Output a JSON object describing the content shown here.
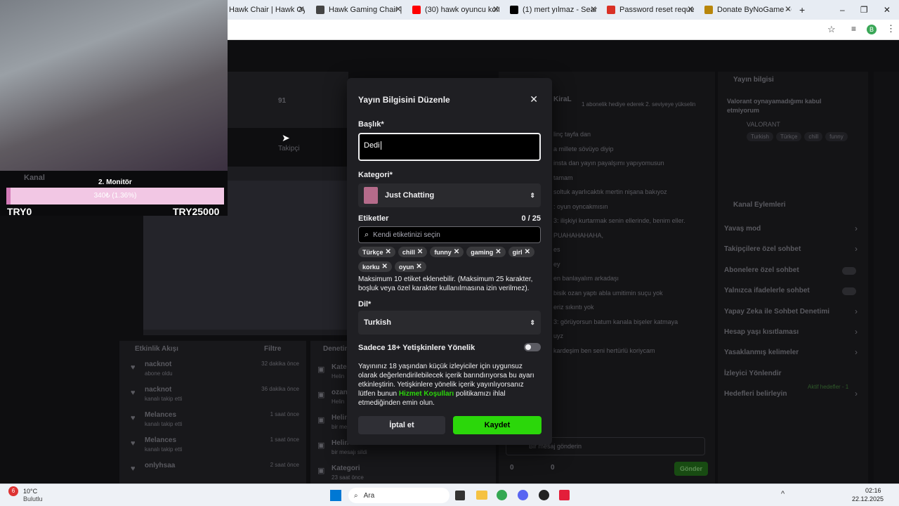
{
  "browser": {
    "tabs": [
      {
        "label": "Hawk Chair | Hawk Oyunc",
        "color": "#ffffff"
      },
      {
        "label": "Hawk Gaming Chair | İsim",
        "color": "#444444"
      },
      {
        "label": "(30) hawk oyuncu koltuğu",
        "color": "#ff0000"
      },
      {
        "label": "(1) mert yılmaz - Sear",
        "color": "#000000"
      },
      {
        "label": "Password reset request -",
        "color": "#d93025"
      },
      {
        "label": "Donate ByNoGame - Gel",
        "color": "#b8860b"
      }
    ],
    "new_tab": "+"
  },
  "overlay": {
    "kanal": "Kanal",
    "monitor": "2. Monitör",
    "progress_text": "340₺ (1.36%)",
    "progress_fraction": 0.0136,
    "goal_left": "TRY0",
    "goal_right": "TRY25000"
  },
  "stats": {
    "followers_count": "91",
    "followers_label": "Takipçi"
  },
  "activity": {
    "title": "Etkinlik Akışı",
    "filter": "Filtre",
    "items": [
      {
        "name": "nacknot",
        "desc": "abone oldu",
        "time": "32 dakika önce"
      },
      {
        "name": "nacknot",
        "desc": "kanalı takip etti",
        "time": "36 dakika önce"
      },
      {
        "name": "Melances",
        "desc": "kanalı takip etti",
        "time": "1 saat önce"
      },
      {
        "name": "Melances",
        "desc": "kanalı takip etti",
        "time": "1 saat önce"
      },
      {
        "name": "onlyhsaa",
        "desc": "",
        "time": "2 saat önce"
      }
    ]
  },
  "denetim": {
    "title": "Denetim",
    "items": [
      {
        "name": "Kate",
        "desc": "Helin"
      },
      {
        "name": "ozan",
        "desc": "Helin"
      },
      {
        "name": "Helin",
        "desc": "bir mesajı sildi"
      },
      {
        "name": "Helin",
        "desc": "bir mesajı sildi"
      },
      {
        "name": "Kategori",
        "desc": "23 saat önce"
      }
    ]
  },
  "chat": {
    "header_user": "KiraL",
    "sub_banner": "1 abonelik hediye ederek 2. seviyeye yükselin",
    "messages": [
      "linç tayfa dan",
      "a millete sövüyo diyip",
      "insta dan yayın payalşımı yapıyomusun",
      "tamam",
      "soltuk ayarlıcaktık mertin nişana bakıyoz",
      ": oyun oyncakmısın",
      "3: ilişkiyi kurtarmak senin ellerinde, benim eller.",
      "PUAHAHAHAHA,",
      "es",
      "ey",
      "en banlayalım arkadaşı",
      "bisik ozan yaptı abla umitimin suçu yok",
      "eriz sıkıntı yok",
      "3: görüyorsun batum kanala bişeler katmaya",
      "uyz",
      "kardeşim ben seni hertürlü koriycam"
    ],
    "input_placeholder": "Bir mesaj gönderin",
    "send": "Gönder",
    "points": "0",
    "bits": "0"
  },
  "stream_info": {
    "title": "Yayın bilgisi",
    "stream_title": "Valorant oynayamadığımı kabul etmiyorum",
    "category": "VALORANT",
    "tags": [
      "Turkish",
      "Türkçe",
      "chill",
      "funny"
    ]
  },
  "channel_actions": {
    "title": "Kanal Eylemleri",
    "items": [
      "Yavaş mod",
      "Takipçilere özel sohbet",
      "Abonelere özel sohbet",
      "Yalnızca ifadelerle sohbet",
      "Yapay Zeka ile Sohbet Denetimi",
      "Hesap yaşı kısıtlaması",
      "Yasaklanmış kelimeler",
      "İzleyici Yönlendir",
      "Hedefleri belirleyin"
    ],
    "goal_status": "Aktif hedefler - 1"
  },
  "modal": {
    "title": "Yayın Bilgisini Düzenle",
    "close": "✕",
    "title_label": "Başlık*",
    "title_value": "Dedi",
    "category_label": "Kategori*",
    "category_value": "Just Chatting",
    "tags_label": "Etiketler",
    "tags_count": "0 / 25",
    "tags_placeholder": "Kendi etiketinizi seçin",
    "tags": [
      "Türkçe",
      "chill",
      "funny",
      "gaming",
      "girl",
      "korku",
      "oyun"
    ],
    "tags_help": "Maksimum 10 etiket eklenebilir. (Maksimum 25 karakter, boşluk veya özel karakter kullanılmasına izin verilmez).",
    "lang_label": "Dil*",
    "lang_value": "Turkish",
    "adult_label": "Sadece 18+ Yetişkinlere Yönelik",
    "adult_help_1": "Yayınınız 18 yaşından küçük izleyiciler için uygunsuz olarak değerlendirilebilecek içerik barındırıyorsa bu ayarı etkinleştirin. Yetişkinlere yönelik içerik yayınlıyorsanız lütfen bunun ",
    "adult_help_link": "Hizmet Koşulları",
    "adult_help_2": " politikamızı ihlal etmediğinden emin olun.",
    "cancel": "İptal et",
    "save": "Kaydet",
    "accent": "#2bd70a"
  },
  "taskbar": {
    "weather_badge": "6",
    "temp": "10°C",
    "weather": "Bulutlu",
    "search": "Ara",
    "time": "02:16",
    "date": "22.12.2025"
  }
}
